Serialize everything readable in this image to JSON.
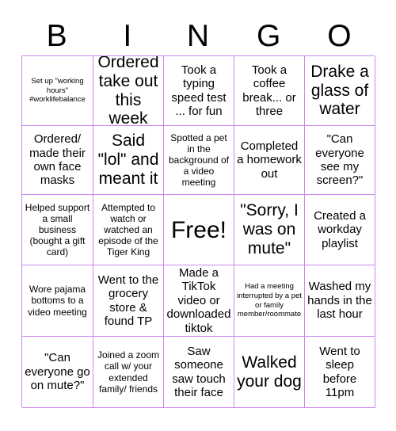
{
  "card": {
    "title_letters": [
      "B",
      "I",
      "N",
      "G",
      "O"
    ],
    "rows": [
      [
        {
          "text": "Set up \"working hours\" #worklifebalance",
          "size": "t-xs"
        },
        {
          "text": "Ordered take out this week",
          "size": "t-xl"
        },
        {
          "text": "Took a typing speed test ... for fun",
          "size": "t-md"
        },
        {
          "text": "Took a coffee break... or three",
          "size": "t-md"
        },
        {
          "text": "Drake a glass of water",
          "size": "t-xl"
        }
      ],
      [
        {
          "text": "Ordered/ made their own face masks",
          "size": "t-md"
        },
        {
          "text": "Said \"lol\" and meant it",
          "size": "t-xl"
        },
        {
          "text": "Spotted a pet in the background of a video meeting",
          "size": "t-sm"
        },
        {
          "text": "Completed a homework out",
          "size": "t-md"
        },
        {
          "text": "\"Can everyone see my screen?\"",
          "size": "t-md"
        }
      ],
      [
        {
          "text": "Helped support a small business (bought a gift card)",
          "size": "t-sm"
        },
        {
          "text": "Attempted to watch or watched an episode of the Tiger King",
          "size": "t-sm"
        },
        {
          "text": "Free!",
          "size": "t-free"
        },
        {
          "text": "\"Sorry, I was on mute\"",
          "size": "t-xl"
        },
        {
          "text": "Created a workday playlist",
          "size": "t-md"
        }
      ],
      [
        {
          "text": "Wore pajama bottoms to a video meeting",
          "size": "t-sm"
        },
        {
          "text": "Went to the grocery store & found TP",
          "size": "t-md"
        },
        {
          "text": "Made a TikTok video or downloaded tiktok",
          "size": "t-md"
        },
        {
          "text": "Had a meeting interrupted by a pet or family member/roommate",
          "size": "t-xs"
        },
        {
          "text": "Washed my hands in the last hour",
          "size": "t-md"
        }
      ],
      [
        {
          "text": "\"Can everyone go on mute?\"",
          "size": "t-md"
        },
        {
          "text": "Joined a zoom call w/ your extended family/ friends",
          "size": "t-sm"
        },
        {
          "text": "Saw someone saw touch their face",
          "size": "t-md"
        },
        {
          "text": "Walked your dog",
          "size": "t-xl"
        },
        {
          "text": "Went to sleep before 11pm",
          "size": "t-md"
        }
      ]
    ]
  },
  "colors": {
    "grid_border": "#cc88ee",
    "text": "#000000",
    "background": "#ffffff"
  }
}
